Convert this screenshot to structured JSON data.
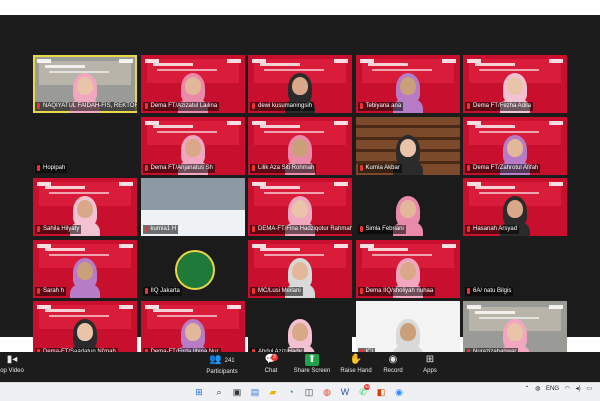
{
  "meeting": {
    "tiles": [
      {
        "name": "NAQIYATUL FAIDAH-FIS, REKTOR...",
        "style": "office",
        "row": 0,
        "col": 0,
        "active": true
      },
      {
        "name": "Dema FT/Azizatul Lailina",
        "style": "banner",
        "row": 0,
        "col": 1
      },
      {
        "name": "dewi kusumaningsih",
        "style": "banner",
        "row": 0,
        "col": 2
      },
      {
        "name": "Tebiyana ana",
        "style": "banner",
        "row": 0,
        "col": 3
      },
      {
        "name": "Dema FT/Fezha Adila",
        "style": "banner",
        "row": 0,
        "col": 4
      },
      {
        "name": "Hopipah",
        "style": "dark",
        "row": 1,
        "col": 0
      },
      {
        "name": "Dema FT/Anjanatus Sh",
        "style": "banner",
        "row": 1,
        "col": 1
      },
      {
        "name": "Lilik Aza Siti Rohmah",
        "style": "banner",
        "row": 1,
        "col": 2
      },
      {
        "name": "Kurnia Akbar",
        "style": "shelf",
        "row": 1,
        "col": 3
      },
      {
        "name": "Dema FT/Zahrotul Afifah",
        "style": "banner",
        "row": 1,
        "col": 4
      },
      {
        "name": "Sahila Hilyaty",
        "style": "banner",
        "row": 2,
        "col": 0
      },
      {
        "name": "kurnia1 H",
        "style": "snow",
        "row": 2,
        "col": 1
      },
      {
        "name": "DEMA-FT/Fina Hadziqotur Rahmah",
        "style": "banner",
        "row": 2,
        "col": 2
      },
      {
        "name": "Simla Febriani",
        "style": "dark",
        "row": 2,
        "col": 3
      },
      {
        "name": "Hasanah Arsyad",
        "style": "banner",
        "row": 2,
        "col": 4
      },
      {
        "name": "Sarah h",
        "style": "banner",
        "row": 3,
        "col": 0
      },
      {
        "name": "IIQ Jakarta",
        "style": "emblem",
        "row": 3,
        "col": 1
      },
      {
        "name": "MC/Lusi Meilani",
        "style": "banner",
        "row": 3,
        "col": 2
      },
      {
        "name": "Dema IIQ/sholiyah nuhaa",
        "style": "banner",
        "row": 3,
        "col": 3
      },
      {
        "name": "6A/ natu Bilgis",
        "style": "dark",
        "row": 3,
        "col": 4
      },
      {
        "name": "Dema-FT/Saadatun Ni'mah",
        "style": "banner",
        "row": 4,
        "col": 0
      },
      {
        "name": "Dema-FT/Firda Ilhina Nur",
        "style": "banner",
        "row": 4,
        "col": 1
      },
      {
        "name": "Abdul Aziz Hady",
        "style": "dark",
        "row": 4,
        "col": 2
      },
      {
        "name": "ICI",
        "style": "white",
        "row": 4,
        "col": 3
      },
      {
        "name": "Nurazizahanwar",
        "style": "office",
        "row": 4,
        "col": 4
      }
    ]
  },
  "controls": {
    "video_label": "op Video",
    "participants_label": "Participants",
    "participants_count": "241",
    "chat_label": "Chat",
    "chat_badge": "3",
    "share_label": "Share Screen",
    "raise_label": "Raise Hand",
    "record_label": "Record",
    "apps_label": "Apps"
  },
  "taskbar": {
    "lang": "ENG",
    "notification_badge": "99"
  },
  "colors": {
    "banner_red": "#c8102e",
    "active_outline": "#e8d94a",
    "share_green": "#1fa34a"
  }
}
